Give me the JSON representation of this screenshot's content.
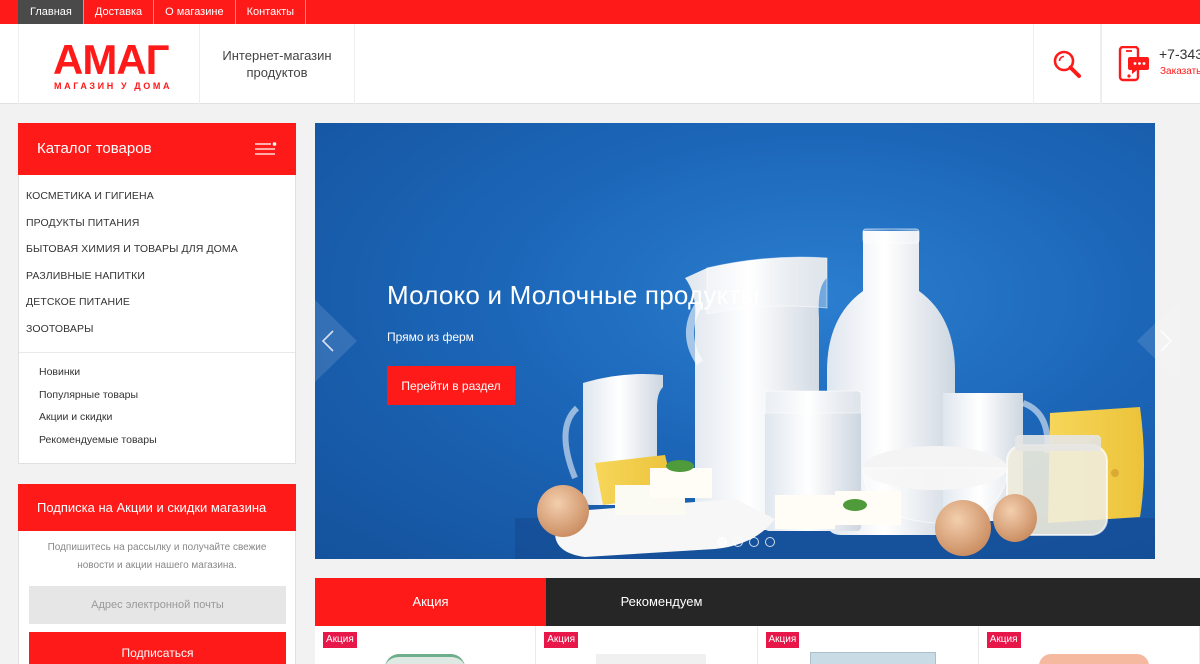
{
  "topnav": {
    "items": [
      {
        "label": "Главная",
        "active": true
      },
      {
        "label": "Доставка",
        "active": false
      },
      {
        "label": "О магазине",
        "active": false
      },
      {
        "label": "Контакты",
        "active": false
      }
    ]
  },
  "header": {
    "logo_text": "АМАГ",
    "logo_subtitle": "МАГАЗИН У ДОМА",
    "tagline": "Интернет-магазин продуктов",
    "phone": "+7-343",
    "callback_link": "Заказать",
    "icons": {
      "search": "search-icon",
      "phone": "phone-chat-icon"
    }
  },
  "catalog": {
    "title": "Каталог товаров",
    "categories": [
      "КОСМЕТИКА И ГИГИЕНА",
      "ПРОДУКТЫ ПИТАНИЯ",
      "БЫТОВАЯ ХИМИЯ И ТОВАРЫ ДЛЯ ДОМА",
      "РАЗЛИВНЫЕ НАПИТКИ",
      "ДЕТСКОЕ ПИТАНИЕ",
      "ЗООТОВАРЫ"
    ],
    "sublinks": [
      "Новинки",
      "Популярные товары",
      "Акции и скидки",
      "Рекомендуемые товары"
    ]
  },
  "subscribe": {
    "title": "Подписка на Акции и скидки магазина",
    "text": "Подпишитесь на рассылку и получайте свежие новости и акции нашего магазина.",
    "email_placeholder": "Адрес электронной почты",
    "button": "Подписаться"
  },
  "banner": {
    "title": "Молоко и Молочные продукты",
    "subtitle": "Прямо из ферм",
    "button": "Перейти в раздел",
    "slides_total": 4,
    "active_slide": 1
  },
  "tabs": [
    {
      "label": "Акция",
      "active": true
    },
    {
      "label": "Рекомендуем",
      "active": false
    }
  ],
  "products": [
    {
      "badge": "Акция"
    },
    {
      "badge": "Акция"
    },
    {
      "badge": "Акция"
    },
    {
      "badge": "Акция"
    }
  ],
  "colors": {
    "accent": "#ff1a1a",
    "dark": "#262626",
    "badge": "#e8174a",
    "banner_blue": "#1c66b8"
  }
}
